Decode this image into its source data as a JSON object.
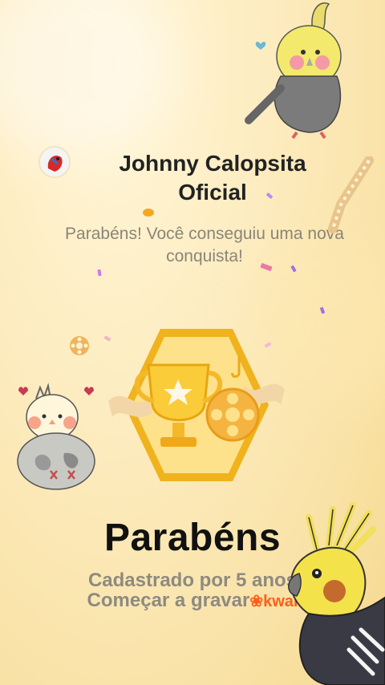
{
  "header": {
    "title": "Johnny Calopsita Oficial",
    "subtitle": "Parabéns! Você conseguiu uma nova conquista!"
  },
  "badge": {
    "icon": "trophy-with-film-reel-badge"
  },
  "main": {
    "heading": "Parabéns",
    "line1": "Cadastrado por 5 anos",
    "line2": "Começar a gravar",
    "brand": "kwai"
  },
  "colors": {
    "badge_gold": "#f0b21d",
    "badge_inner": "#fde28b",
    "brand_orange": "#ff5e1a",
    "heart_red": "#e0433f"
  }
}
